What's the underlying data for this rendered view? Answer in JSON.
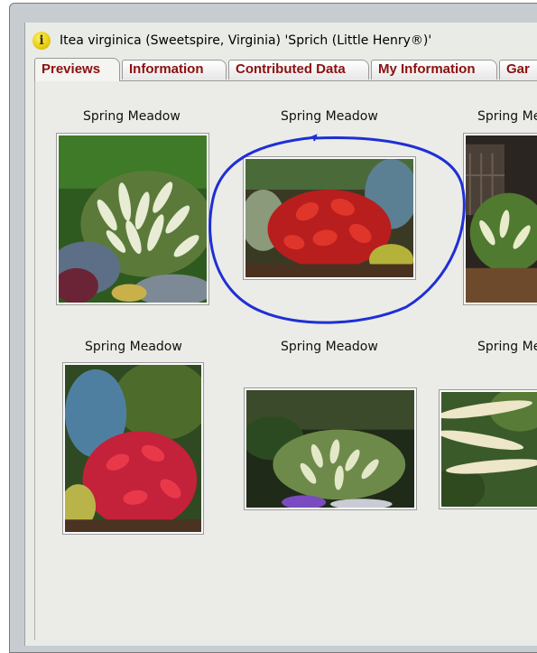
{
  "window": {
    "title": "Itea virginica (Sweetspire, Virginia) 'Sprich (Little Henry®)'",
    "title_icon": "info-icon"
  },
  "tabs": [
    {
      "label": "Previews",
      "active": true
    },
    {
      "label": "Information",
      "active": false
    },
    {
      "label": "Contributed Data",
      "active": false
    },
    {
      "label": "My Information",
      "active": false
    },
    {
      "label": "Gar",
      "active": false
    }
  ],
  "previews": [
    {
      "caption": "Spring Meadow",
      "subject": "white-flowering-shrub"
    },
    {
      "caption": "Spring Meadow",
      "subject": "red-foliage-shrub",
      "circled": true
    },
    {
      "caption": "Spring Me",
      "subject": "shrub-by-shed"
    },
    {
      "caption": "Spring Meadow",
      "subject": "red-foliage-with-blue-conifer"
    },
    {
      "caption": "Spring Meadow",
      "subject": "white-flowering-mound"
    },
    {
      "caption": "Spring Me",
      "subject": "flower-racemes-closeup"
    }
  ],
  "colors": {
    "tab_text": "#8b1010",
    "annotation": "#1f2fd6",
    "panel": "#ebece7"
  }
}
